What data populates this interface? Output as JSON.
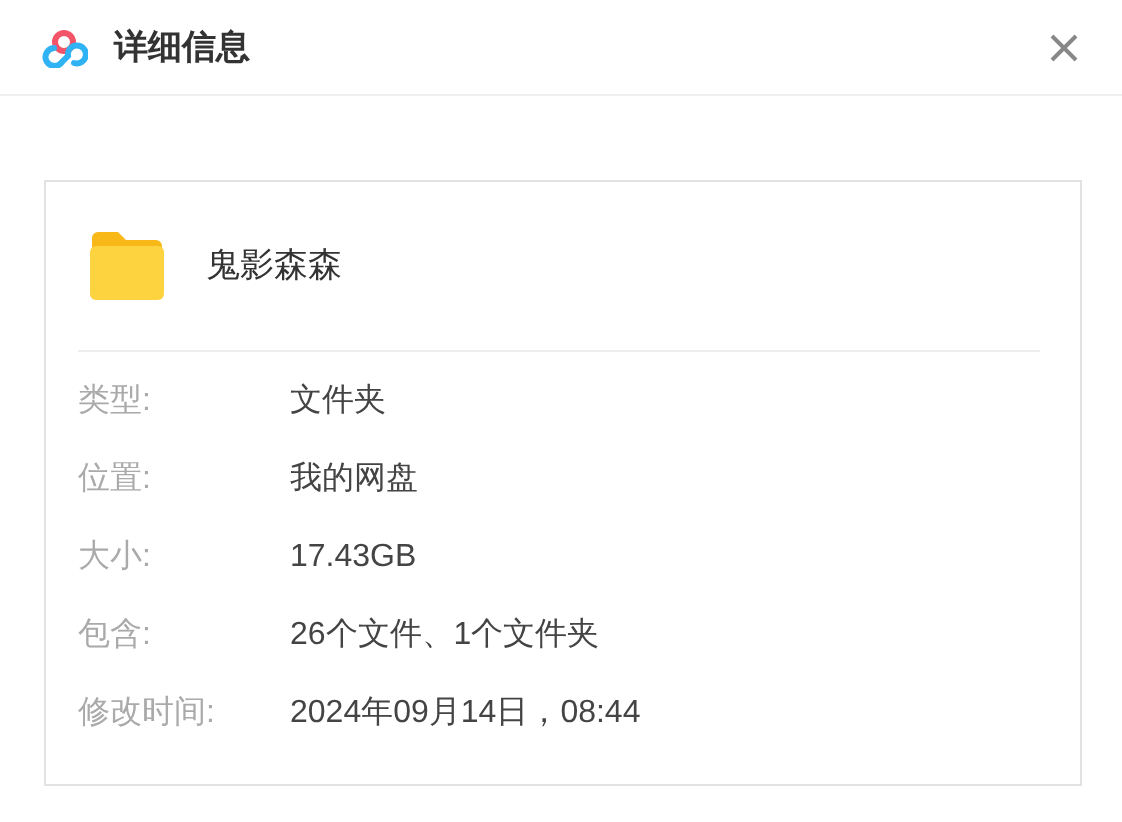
{
  "window": {
    "title": "详细信息"
  },
  "item": {
    "name": "鬼影森森"
  },
  "details": [
    {
      "label": "类型:",
      "value": "文件夹"
    },
    {
      "label": "位置:",
      "value": "我的网盘"
    },
    {
      "label": "大小:",
      "value": "17.43GB"
    },
    {
      "label": "包含:",
      "value": "26个文件、1个文件夹"
    },
    {
      "label": "修改时间:",
      "value": "2024年09月14日，08:44"
    }
  ]
}
